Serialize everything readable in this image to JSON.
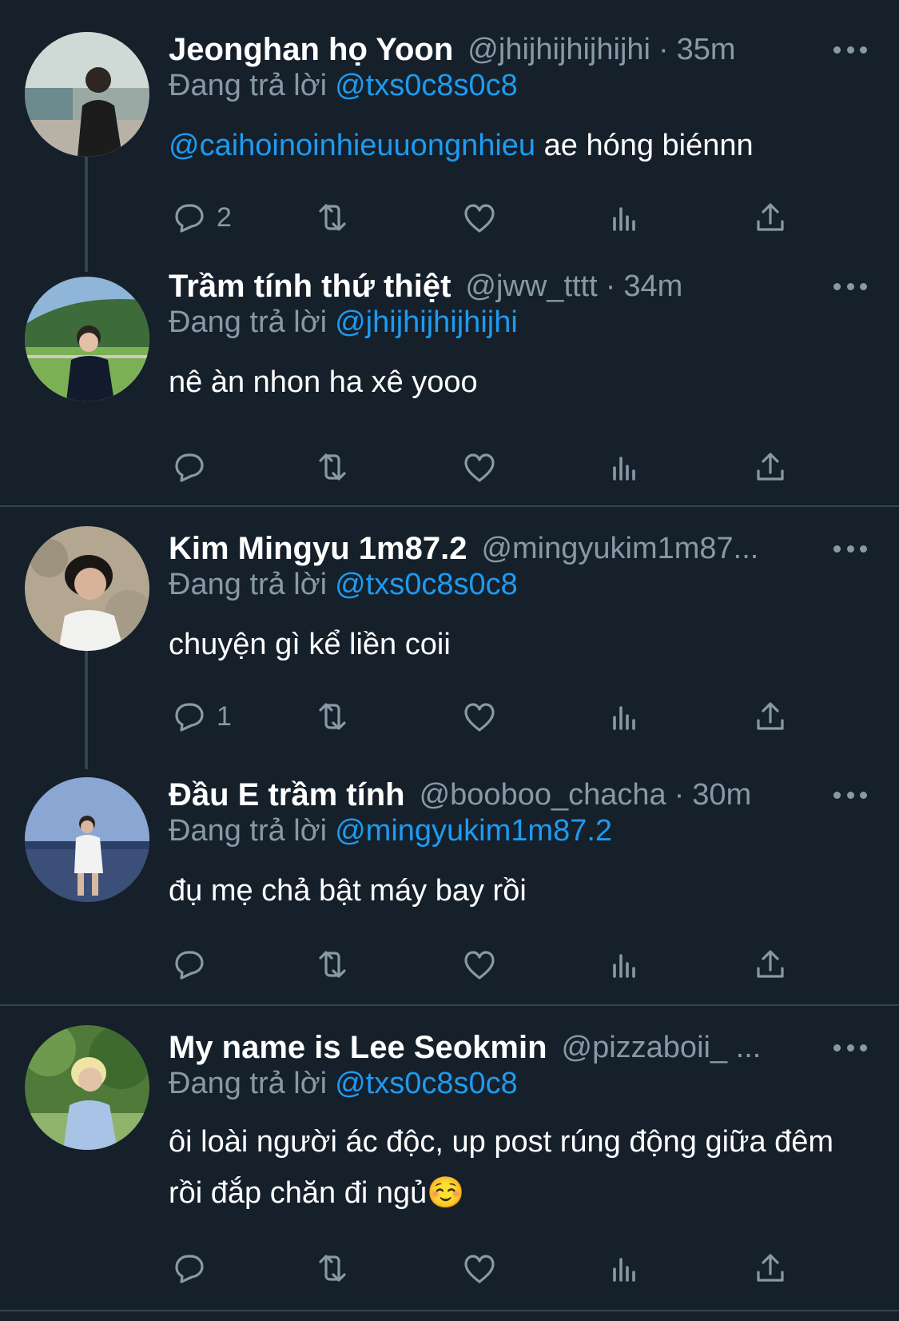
{
  "replying_label": "Đang trả lời",
  "colors": {
    "background": "#15202b",
    "secondary_text": "#8899a6",
    "link": "#1d9bf0",
    "divider": "#38444d"
  },
  "tweets": [
    {
      "name": "Jeonghan họ Yoon",
      "handle": "@jhijhijhijhijhi",
      "time": "35m",
      "reply_to": "@txs0c8s0c8",
      "mention": "@caihoinoinhieuuongnhieu",
      "text": " ae hóng biénnn",
      "reply_count": "2"
    },
    {
      "name": "Trầm tính thứ thiệt",
      "handle": "@jww_tttt",
      "time": "34m",
      "reply_to": "@jhijhijhijhijhi",
      "text": "nê àn nhon ha xê yooo",
      "reply_count": ""
    },
    {
      "name": "Kim Mingyu 1m87.2",
      "handle": "@mingyukim1m87...",
      "time": "",
      "reply_to": "@txs0c8s0c8",
      "text": "chuyện gì kể liền coii",
      "reply_count": "1"
    },
    {
      "name": "Đầu E trầm tính",
      "handle": "@booboo_chacha",
      "time": "30m",
      "reply_to": "@mingyukim1m87.2",
      "text": "đụ mẹ chả bật máy bay rồi",
      "reply_count": ""
    },
    {
      "name": "My name is Lee Seokmin",
      "handle": "@pizzaboii_ ...",
      "time": "",
      "reply_to": "@txs0c8s0c8",
      "text": "ôi loài người ác độc, up post rúng động giữa đêm rồi đắp chăn đi ngủ☺️",
      "reply_count": ""
    }
  ],
  "icons": [
    "reply-icon",
    "retweet-icon",
    "like-icon",
    "analytics-icon",
    "share-icon",
    "more-icon"
  ]
}
